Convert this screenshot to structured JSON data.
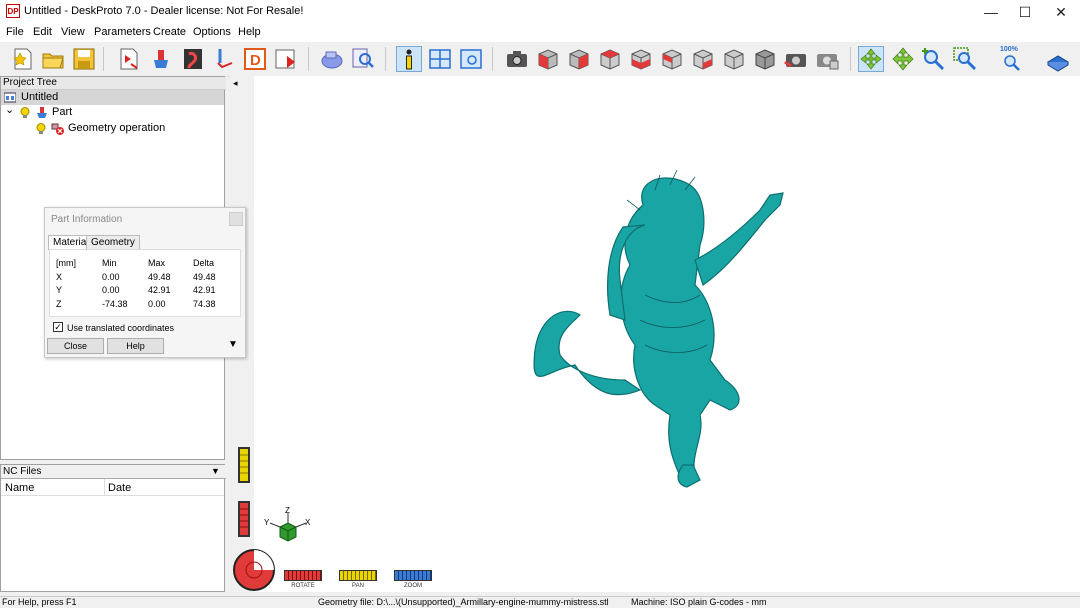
{
  "window": {
    "title": "Untitled - DeskProto 7.0 - Dealer license: Not For Resale!",
    "logo_text": "DP",
    "min_glyph": "—",
    "max_glyph": "☐",
    "close_glyph": "✕"
  },
  "menu": [
    "File",
    "Edit",
    "View",
    "Parameters",
    "Create",
    "Options",
    "Help"
  ],
  "toolbar": {
    "zoom_label": "100%"
  },
  "project_tree": {
    "header": "Project Tree",
    "items": [
      "Untitled",
      "Part",
      "Geometry operation"
    ],
    "expand_glyph": "⌄"
  },
  "part_info": {
    "title": "Part Information",
    "tabs": [
      "Material",
      "Geometry"
    ],
    "headers": [
      "[mm]",
      "Min",
      "Max",
      "Delta"
    ],
    "rows": [
      [
        "X",
        "0.00",
        "49.48",
        "49.48"
      ],
      [
        "Y",
        "0.00",
        "42.91",
        "42.91"
      ],
      [
        "Z",
        "-74.38",
        "0.00",
        "74.38"
      ]
    ],
    "checkbox_label": "Use translated coordinates",
    "checkbox_checked": true,
    "checkbox_glyph": "✓",
    "close_label": "Close",
    "help_label": "Help",
    "more_glyph": "▼"
  },
  "nc_files": {
    "header": "NC Files",
    "columns": [
      "Name",
      "Date"
    ],
    "dropdown_glyph": "▼"
  },
  "viewport": {
    "collapse_glyph": "◂",
    "axes": {
      "x": "X",
      "y": "Y",
      "z": "Z"
    },
    "nav": [
      "ROTATE",
      "PAN",
      "ZOOM"
    ],
    "model_color": "#1aa5a5"
  },
  "status": {
    "help": "For Help, press F1",
    "geometry": "Geometry file: D:\\...\\(Unsupported)_Armillary-engine-mummy-mistress.stl",
    "machine": "Machine: ISO plain G-codes - mm"
  }
}
